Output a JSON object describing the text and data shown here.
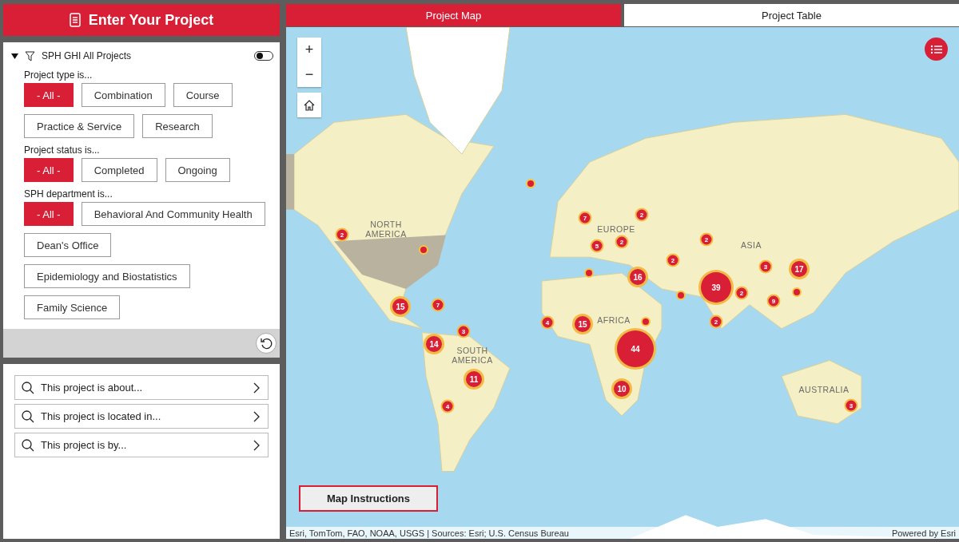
{
  "header": {
    "title": "Enter Your Project"
  },
  "filter": {
    "title": "SPH GHI All Projects",
    "expanded": true,
    "on": false,
    "groups": [
      {
        "label": "Project type is...",
        "options": [
          {
            "label": "- All -",
            "selected": true
          },
          {
            "label": "Combination",
            "selected": false
          },
          {
            "label": "Course",
            "selected": false
          },
          {
            "label": "Practice & Service",
            "selected": false
          },
          {
            "label": "Research",
            "selected": false
          }
        ]
      },
      {
        "label": "Project status is...",
        "options": [
          {
            "label": "- All -",
            "selected": true
          },
          {
            "label": "Completed",
            "selected": false
          },
          {
            "label": "Ongoing",
            "selected": false
          }
        ]
      },
      {
        "label": "SPH department is...",
        "options": [
          {
            "label": "- All -",
            "selected": true
          },
          {
            "label": "Behavioral And Community Health",
            "selected": false
          },
          {
            "label": "Dean's Office",
            "selected": false
          },
          {
            "label": "Epidemiology and Biostatistics",
            "selected": false
          },
          {
            "label": "Family Science",
            "selected": false
          }
        ]
      }
    ]
  },
  "search_items": [
    {
      "label": "This project is about..."
    },
    {
      "label": "This project is located in..."
    },
    {
      "label": "This project is by..."
    }
  ],
  "tabs": [
    {
      "label": "Project Map",
      "selected": true
    },
    {
      "label": "Project Table",
      "selected": false
    }
  ],
  "map": {
    "region_labels": [
      "NORTH AMERICA",
      "EUROPE",
      "ASIA",
      "AFRICA",
      "SOUTH AMERICA",
      "AUSTRALIA"
    ],
    "markers": [
      {
        "kind": "point"
      },
      {
        "kind": "cluster",
        "count": "2"
      },
      {
        "kind": "point"
      },
      {
        "kind": "cluster",
        "count": "7"
      },
      {
        "kind": "cluster",
        "count": "2"
      },
      {
        "kind": "cluster",
        "count": "5"
      },
      {
        "kind": "cluster",
        "count": "2"
      },
      {
        "kind": "cluster",
        "count": "2"
      },
      {
        "kind": "cluster",
        "count": "2"
      },
      {
        "kind": "cluster",
        "count": "3"
      },
      {
        "kind": "cluster",
        "count": "17"
      },
      {
        "kind": "point"
      },
      {
        "kind": "cluster",
        "count": "16"
      },
      {
        "kind": "point"
      },
      {
        "kind": "cluster",
        "count": "39"
      },
      {
        "kind": "cluster",
        "count": "2"
      },
      {
        "kind": "cluster",
        "count": "9"
      },
      {
        "kind": "point"
      },
      {
        "kind": "cluster",
        "count": "15"
      },
      {
        "kind": "cluster",
        "count": "7"
      },
      {
        "kind": "cluster",
        "count": "4"
      },
      {
        "kind": "cluster",
        "count": "15"
      },
      {
        "kind": "point"
      },
      {
        "kind": "cluster",
        "count": "2"
      },
      {
        "kind": "cluster",
        "count": "3"
      },
      {
        "kind": "cluster",
        "count": "14"
      },
      {
        "kind": "cluster",
        "count": "44"
      },
      {
        "kind": "cluster",
        "count": "11"
      },
      {
        "kind": "cluster",
        "count": "10"
      },
      {
        "kind": "cluster",
        "count": "4"
      },
      {
        "kind": "cluster",
        "count": "3"
      }
    ],
    "zoom_in": "+",
    "zoom_out": "−",
    "instructions_button": "Map Instructions",
    "attribution": "Esri, TomTom, FAO, NOAA, USGS | Sources: Esri; U.S. Census Bureau",
    "powered_by": "Powered by Esri"
  }
}
